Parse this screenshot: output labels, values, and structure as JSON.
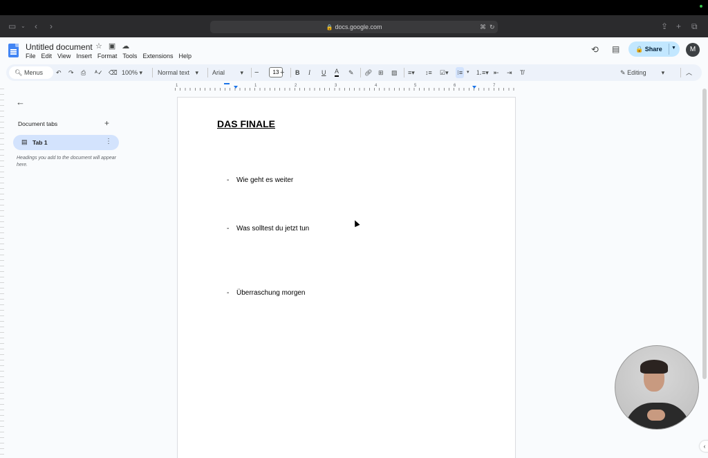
{
  "browser": {
    "url": "docs.google.com"
  },
  "app": {
    "doc_title": "Untitled document",
    "menu": [
      "File",
      "Edit",
      "View",
      "Insert",
      "Format",
      "Tools",
      "Extensions",
      "Help"
    ],
    "share_label": "Share",
    "avatar_initial": "M"
  },
  "toolbar": {
    "menus_label": "Menus",
    "zoom": "100%",
    "style": "Normal text",
    "font": "Arial",
    "font_size": "13",
    "mode": "Editing",
    "minus": "−",
    "plus": "+",
    "bold": "B",
    "italic": "I",
    "underline": "U",
    "text_color": "A"
  },
  "ruler": {
    "numbers": [
      "1",
      "1",
      "2",
      "3",
      "4",
      "5",
      "6",
      "7"
    ]
  },
  "sidebar": {
    "heading": "Document tabs",
    "tab_label": "Tab 1",
    "hint": "Headings you add to the document will appear here."
  },
  "document": {
    "heading": "DAS FINALE",
    "bullets": [
      {
        "dash": "-",
        "text": "Wie geht es weiter"
      },
      {
        "dash": "-",
        "text": "Was solltest du jetzt tun"
      },
      {
        "dash": "-",
        "text": "Überraschung morgen"
      }
    ]
  },
  "colors": {
    "app_bg": "#f9fbfd",
    "toolbar_bg": "#edf2fa",
    "share_bg": "#c2e7ff",
    "tab_active_bg": "#d3e3fd",
    "docs_blue": "#4285f4"
  }
}
